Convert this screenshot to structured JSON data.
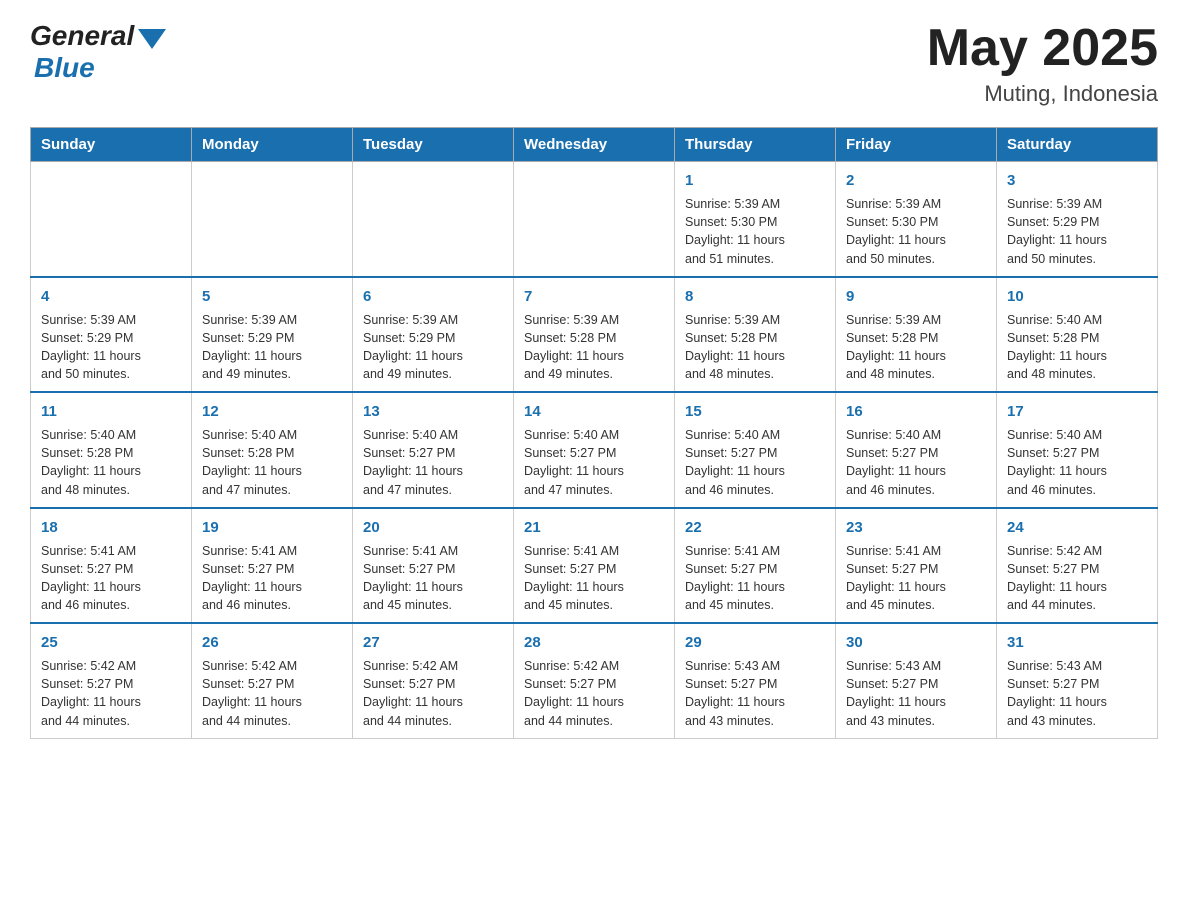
{
  "header": {
    "logo_general": "General",
    "logo_blue": "Blue",
    "month_year": "May 2025",
    "location": "Muting, Indonesia"
  },
  "days_of_week": [
    "Sunday",
    "Monday",
    "Tuesday",
    "Wednesday",
    "Thursday",
    "Friday",
    "Saturday"
  ],
  "weeks": [
    [
      {
        "day": "",
        "info": ""
      },
      {
        "day": "",
        "info": ""
      },
      {
        "day": "",
        "info": ""
      },
      {
        "day": "",
        "info": ""
      },
      {
        "day": "1",
        "info": "Sunrise: 5:39 AM\nSunset: 5:30 PM\nDaylight: 11 hours\nand 51 minutes."
      },
      {
        "day": "2",
        "info": "Sunrise: 5:39 AM\nSunset: 5:30 PM\nDaylight: 11 hours\nand 50 minutes."
      },
      {
        "day": "3",
        "info": "Sunrise: 5:39 AM\nSunset: 5:29 PM\nDaylight: 11 hours\nand 50 minutes."
      }
    ],
    [
      {
        "day": "4",
        "info": "Sunrise: 5:39 AM\nSunset: 5:29 PM\nDaylight: 11 hours\nand 50 minutes."
      },
      {
        "day": "5",
        "info": "Sunrise: 5:39 AM\nSunset: 5:29 PM\nDaylight: 11 hours\nand 49 minutes."
      },
      {
        "day": "6",
        "info": "Sunrise: 5:39 AM\nSunset: 5:29 PM\nDaylight: 11 hours\nand 49 minutes."
      },
      {
        "day": "7",
        "info": "Sunrise: 5:39 AM\nSunset: 5:28 PM\nDaylight: 11 hours\nand 49 minutes."
      },
      {
        "day": "8",
        "info": "Sunrise: 5:39 AM\nSunset: 5:28 PM\nDaylight: 11 hours\nand 48 minutes."
      },
      {
        "day": "9",
        "info": "Sunrise: 5:39 AM\nSunset: 5:28 PM\nDaylight: 11 hours\nand 48 minutes."
      },
      {
        "day": "10",
        "info": "Sunrise: 5:40 AM\nSunset: 5:28 PM\nDaylight: 11 hours\nand 48 minutes."
      }
    ],
    [
      {
        "day": "11",
        "info": "Sunrise: 5:40 AM\nSunset: 5:28 PM\nDaylight: 11 hours\nand 48 minutes."
      },
      {
        "day": "12",
        "info": "Sunrise: 5:40 AM\nSunset: 5:28 PM\nDaylight: 11 hours\nand 47 minutes."
      },
      {
        "day": "13",
        "info": "Sunrise: 5:40 AM\nSunset: 5:27 PM\nDaylight: 11 hours\nand 47 minutes."
      },
      {
        "day": "14",
        "info": "Sunrise: 5:40 AM\nSunset: 5:27 PM\nDaylight: 11 hours\nand 47 minutes."
      },
      {
        "day": "15",
        "info": "Sunrise: 5:40 AM\nSunset: 5:27 PM\nDaylight: 11 hours\nand 46 minutes."
      },
      {
        "day": "16",
        "info": "Sunrise: 5:40 AM\nSunset: 5:27 PM\nDaylight: 11 hours\nand 46 minutes."
      },
      {
        "day": "17",
        "info": "Sunrise: 5:40 AM\nSunset: 5:27 PM\nDaylight: 11 hours\nand 46 minutes."
      }
    ],
    [
      {
        "day": "18",
        "info": "Sunrise: 5:41 AM\nSunset: 5:27 PM\nDaylight: 11 hours\nand 46 minutes."
      },
      {
        "day": "19",
        "info": "Sunrise: 5:41 AM\nSunset: 5:27 PM\nDaylight: 11 hours\nand 46 minutes."
      },
      {
        "day": "20",
        "info": "Sunrise: 5:41 AM\nSunset: 5:27 PM\nDaylight: 11 hours\nand 45 minutes."
      },
      {
        "day": "21",
        "info": "Sunrise: 5:41 AM\nSunset: 5:27 PM\nDaylight: 11 hours\nand 45 minutes."
      },
      {
        "day": "22",
        "info": "Sunrise: 5:41 AM\nSunset: 5:27 PM\nDaylight: 11 hours\nand 45 minutes."
      },
      {
        "day": "23",
        "info": "Sunrise: 5:41 AM\nSunset: 5:27 PM\nDaylight: 11 hours\nand 45 minutes."
      },
      {
        "day": "24",
        "info": "Sunrise: 5:42 AM\nSunset: 5:27 PM\nDaylight: 11 hours\nand 44 minutes."
      }
    ],
    [
      {
        "day": "25",
        "info": "Sunrise: 5:42 AM\nSunset: 5:27 PM\nDaylight: 11 hours\nand 44 minutes."
      },
      {
        "day": "26",
        "info": "Sunrise: 5:42 AM\nSunset: 5:27 PM\nDaylight: 11 hours\nand 44 minutes."
      },
      {
        "day": "27",
        "info": "Sunrise: 5:42 AM\nSunset: 5:27 PM\nDaylight: 11 hours\nand 44 minutes."
      },
      {
        "day": "28",
        "info": "Sunrise: 5:42 AM\nSunset: 5:27 PM\nDaylight: 11 hours\nand 44 minutes."
      },
      {
        "day": "29",
        "info": "Sunrise: 5:43 AM\nSunset: 5:27 PM\nDaylight: 11 hours\nand 43 minutes."
      },
      {
        "day": "30",
        "info": "Sunrise: 5:43 AM\nSunset: 5:27 PM\nDaylight: 11 hours\nand 43 minutes."
      },
      {
        "day": "31",
        "info": "Sunrise: 5:43 AM\nSunset: 5:27 PM\nDaylight: 11 hours\nand 43 minutes."
      }
    ]
  ]
}
